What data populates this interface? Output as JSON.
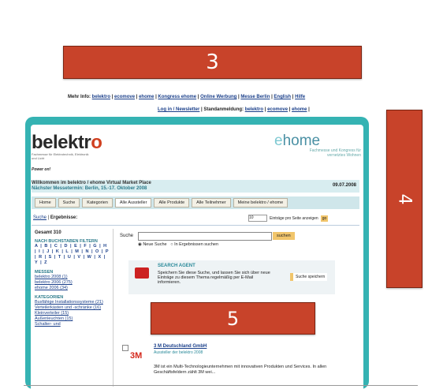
{
  "markers": {
    "m3": "3",
    "m4": "4",
    "m5": "5"
  },
  "toplinks": {
    "prefix": "Mehr Info:",
    "links": [
      "belektro",
      "ecomove",
      "ehome",
      "Kongress ehome",
      "Online Werbung",
      "Messe Berlin",
      "English",
      "Hilfe"
    ],
    "login": "Log in / Newsletter",
    "stand_prefix": "Standanmeldung:",
    "stand_links": [
      "belektro",
      "ecomove",
      "ehome"
    ]
  },
  "header": {
    "belektro_logo": "belektro",
    "belektro_tagline": "Fachmesse für Elektrotechnik, Elektronik und Licht",
    "ehome_logo": "ehome",
    "ehome_tagline": "Fachmesse und Kongress für vernetztes Wohnen",
    "poweron": "Power on!"
  },
  "welcome": {
    "title": "Willkommen im belektro / ehome Virtual Market Place",
    "next": "Nächster Messetermin: Berlin, 15.-17. Oktober 2008",
    "date": "09.07.2008"
  },
  "nav": [
    "Home",
    "Suche",
    "Kategorien",
    "Alle Aussteller",
    "Alle Produkte",
    "Alle Teilnehmer",
    "Meine belektro / ehome"
  ],
  "crumb": {
    "link": "Suche",
    "sep": " | ",
    "text": "Ergebnisse:"
  },
  "perpage": {
    "value": "10",
    "label": "Einträge pro Seite anzeigen",
    "go": "go"
  },
  "sidebar": {
    "gesamt": "Gesamt 310",
    "filter_heading": "NACH BUCHSTABEN FILTERN",
    "letters": "A | B | C | D | E | F | G | H | I | J | K | L | M | N | O | P | R | S | T | U | V | W | X | Y | Z",
    "messen_heading": "MESSEN",
    "messen": [
      "belektro 2008 (1)",
      "belektro 2006 (275)",
      "ehome 2006 (34)"
    ],
    "kategorien_heading": "KATEGORIEN",
    "kategorien": [
      "Busfähige Installationssysteme (21)",
      "Verteilerkästen und -schränke (16)",
      "Kleinverteiler (15)",
      "Außenleuchten (15)",
      "Schalter- und"
    ]
  },
  "search": {
    "label": "Suche",
    "button": "suchen",
    "radio1": "Neue Suche",
    "radio2": "In Ergebnissen suchen"
  },
  "agent": {
    "title": "SEARCH AGENT",
    "body": "Speichern Sie diese Suche, und lassen Sie sich über neue Einträge zu diesem Thema regelmäßig per E-Mail informieren.",
    "button": "Suche speichern"
  },
  "result": {
    "logo": "3M",
    "title": "3 M Deutschland GmbH",
    "subtitle": "Aussteller der belektro 2008",
    "desc": "3M ist ein Multi-Technologieunternehmen mit innovativen Produkten und Services. In allen Geschäftsfeldern zählt 3M wei..."
  }
}
